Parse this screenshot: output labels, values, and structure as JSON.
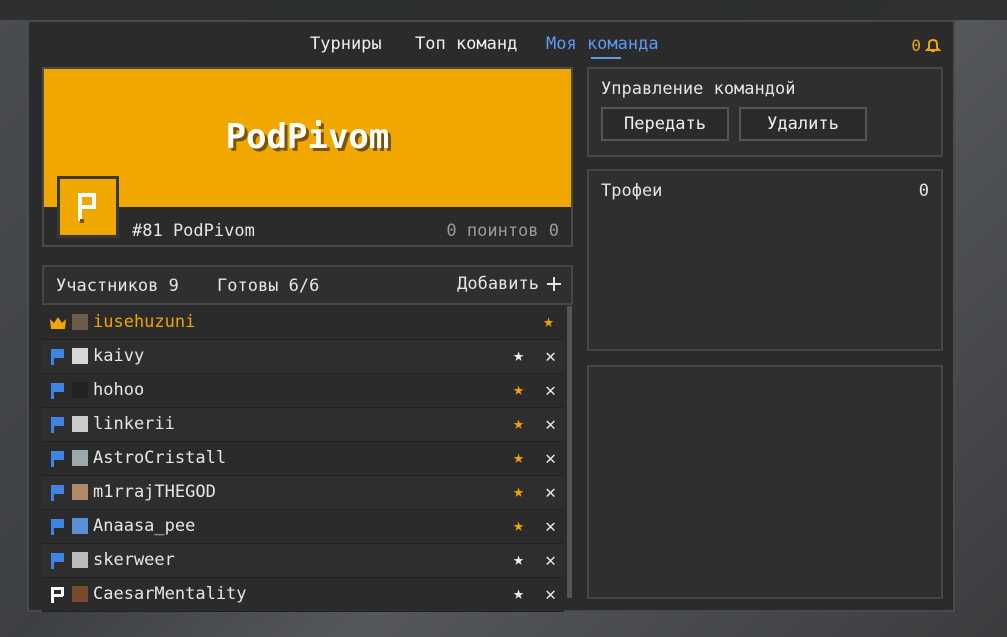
{
  "nav": {
    "tabs": [
      {
        "label": "Турниры"
      },
      {
        "label": "Топ команд"
      },
      {
        "label": "Моя команда"
      }
    ],
    "notifications": "0",
    "bell_icon": "bell-icon"
  },
  "team": {
    "name": "PodPivom",
    "icon_letter": "P",
    "rank_line": "#81 PodPivom",
    "points_line": "0 поинтов 0",
    "banner_color": "#f0a800"
  },
  "management": {
    "title": "Управление командой",
    "transfer_label": "Передать",
    "delete_label": "Удалить"
  },
  "trophies": {
    "label": "Трофеи",
    "value": "0"
  },
  "members": {
    "count_label": "Участников 9",
    "ready_label": "Готовы 6/6",
    "add_label": "Добавить",
    "list": [
      {
        "name": "iusehuzuni",
        "role": "leader",
        "star": "gold"
      },
      {
        "name": "kaivy",
        "role": "member",
        "star": "white"
      },
      {
        "name": "hohoo",
        "role": "member",
        "star": "gold"
      },
      {
        "name": "linkerii",
        "role": "member",
        "star": "gold"
      },
      {
        "name": "AstroCristall",
        "role": "member",
        "star": "gold"
      },
      {
        "name": "m1rrajTHEGOD",
        "role": "member",
        "star": "gold"
      },
      {
        "name": "Anaasa_pee",
        "role": "member",
        "star": "gold"
      },
      {
        "name": "skerweer",
        "role": "member",
        "star": "white"
      },
      {
        "name": "CaesarMentality",
        "role": "inactive",
        "star": "white"
      }
    ]
  },
  "colors": {
    "accent_blue": "#5b9bf0",
    "gold": "#f0a500",
    "flag_blue": "#3f84e5"
  }
}
